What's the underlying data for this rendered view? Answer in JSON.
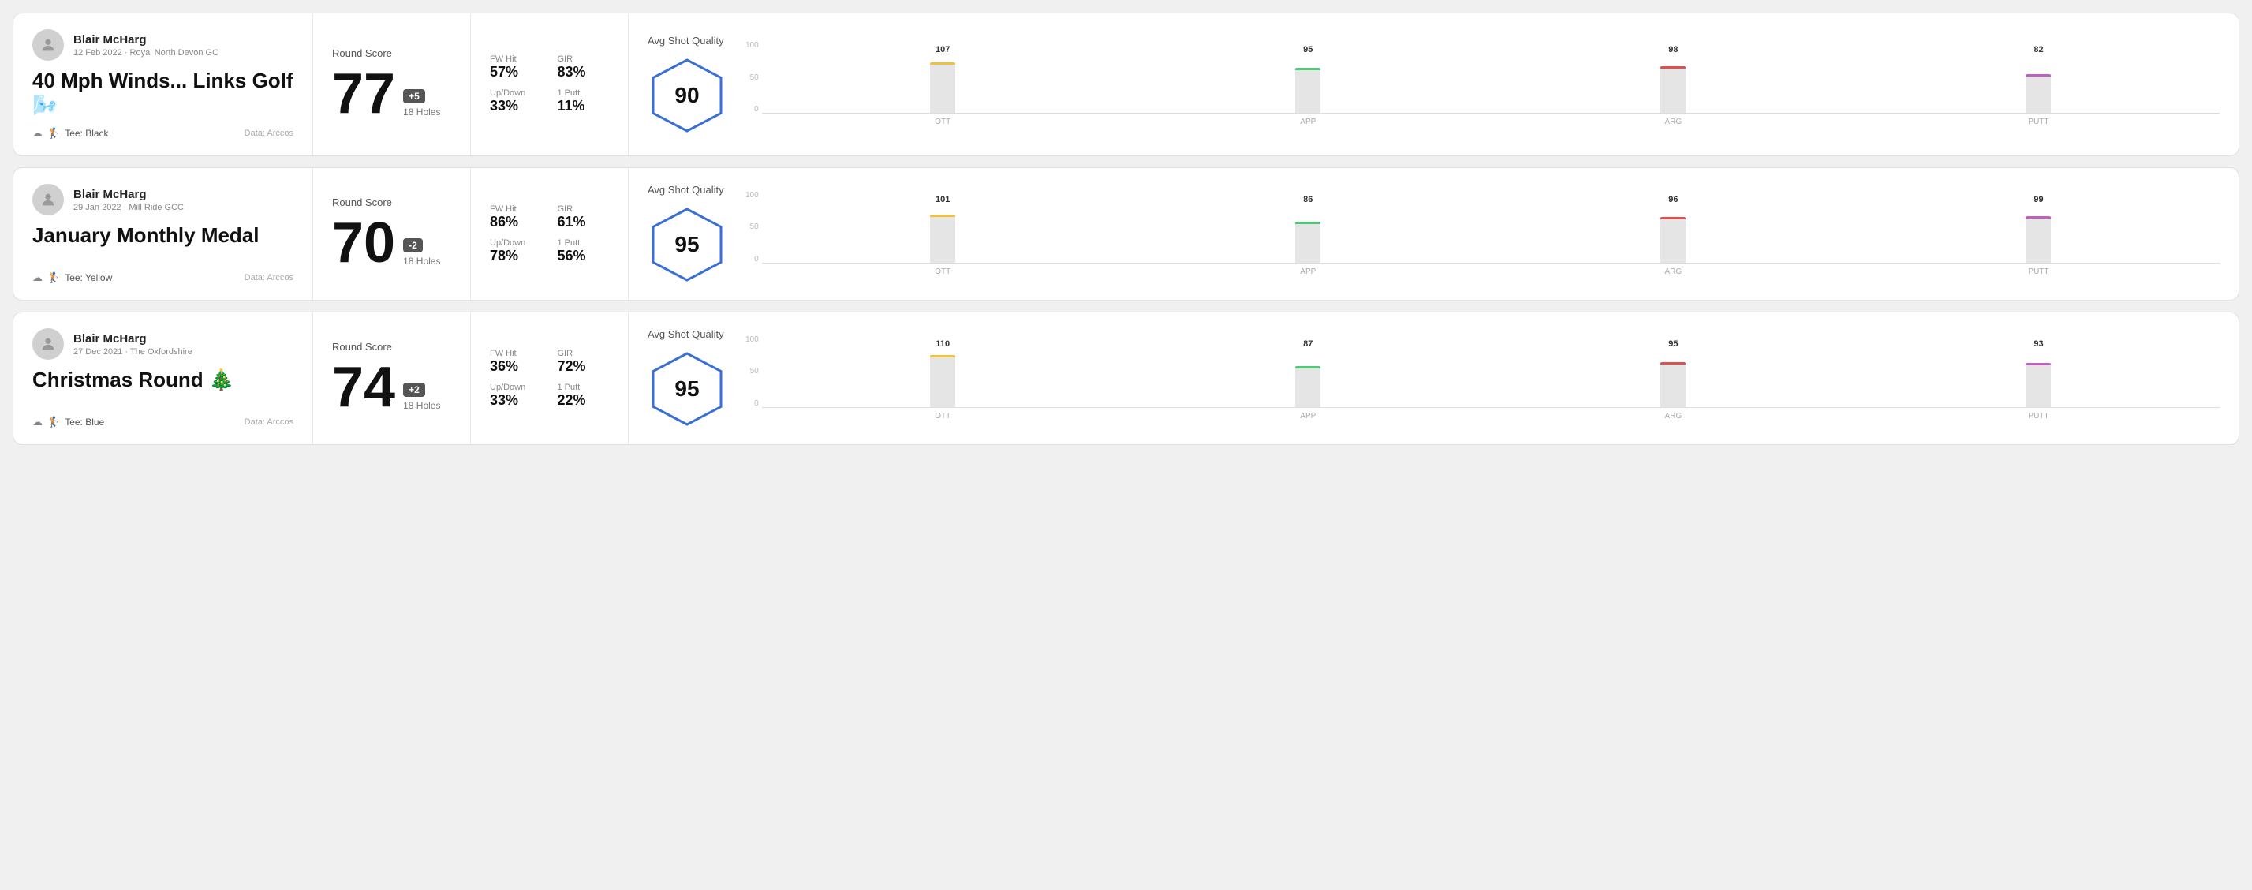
{
  "rounds": [
    {
      "id": "round-1",
      "player": {
        "name": "Blair McHarg",
        "date": "12 Feb 2022",
        "course": "Royal North Devon GC"
      },
      "title": "40 Mph Winds... Links Golf 🌬️",
      "tee": "Black",
      "data_source": "Data: Arccos",
      "score": {
        "label": "Round Score",
        "number": "77",
        "badge": "+5",
        "holes": "18 Holes"
      },
      "stats": [
        {
          "label": "FW Hit",
          "value": "57%"
        },
        {
          "label": "GIR",
          "value": "83%"
        },
        {
          "label": "Up/Down",
          "value": "33%"
        },
        {
          "label": "1 Putt",
          "value": "11%"
        }
      ],
      "quality": {
        "label": "Avg Shot Quality",
        "score": "90"
      },
      "chart": {
        "bars": [
          {
            "label": "OTT",
            "value": 107,
            "color": "#f0c040"
          },
          {
            "label": "APP",
            "value": 95,
            "color": "#50c878"
          },
          {
            "label": "ARG",
            "value": 98,
            "color": "#e05050"
          },
          {
            "label": "PUTT",
            "value": 82,
            "color": "#c060c0"
          }
        ],
        "y_labels": [
          "100",
          "50",
          "0"
        ]
      }
    },
    {
      "id": "round-2",
      "player": {
        "name": "Blair McHarg",
        "date": "29 Jan 2022",
        "course": "Mill Ride GCC"
      },
      "title": "January Monthly Medal",
      "tee": "Yellow",
      "data_source": "Data: Arccos",
      "score": {
        "label": "Round Score",
        "number": "70",
        "badge": "-2",
        "holes": "18 Holes"
      },
      "stats": [
        {
          "label": "FW Hit",
          "value": "86%"
        },
        {
          "label": "GIR",
          "value": "61%"
        },
        {
          "label": "Up/Down",
          "value": "78%"
        },
        {
          "label": "1 Putt",
          "value": "56%"
        }
      ],
      "quality": {
        "label": "Avg Shot Quality",
        "score": "95"
      },
      "chart": {
        "bars": [
          {
            "label": "OTT",
            "value": 101,
            "color": "#f0c040"
          },
          {
            "label": "APP",
            "value": 86,
            "color": "#50c878"
          },
          {
            "label": "ARG",
            "value": 96,
            "color": "#e05050"
          },
          {
            "label": "PUTT",
            "value": 99,
            "color": "#c060c0"
          }
        ],
        "y_labels": [
          "100",
          "50",
          "0"
        ]
      }
    },
    {
      "id": "round-3",
      "player": {
        "name": "Blair McHarg",
        "date": "27 Dec 2021",
        "course": "The Oxfordshire"
      },
      "title": "Christmas Round 🎄",
      "tee": "Blue",
      "data_source": "Data: Arccos",
      "score": {
        "label": "Round Score",
        "number": "74",
        "badge": "+2",
        "holes": "18 Holes"
      },
      "stats": [
        {
          "label": "FW Hit",
          "value": "36%"
        },
        {
          "label": "GIR",
          "value": "72%"
        },
        {
          "label": "Up/Down",
          "value": "33%"
        },
        {
          "label": "1 Putt",
          "value": "22%"
        }
      ],
      "quality": {
        "label": "Avg Shot Quality",
        "score": "95"
      },
      "chart": {
        "bars": [
          {
            "label": "OTT",
            "value": 110,
            "color": "#f0c040"
          },
          {
            "label": "APP",
            "value": 87,
            "color": "#50c878"
          },
          {
            "label": "ARG",
            "value": 95,
            "color": "#e05050"
          },
          {
            "label": "PUTT",
            "value": 93,
            "color": "#c060c0"
          }
        ],
        "y_labels": [
          "100",
          "50",
          "0"
        ]
      }
    }
  ]
}
